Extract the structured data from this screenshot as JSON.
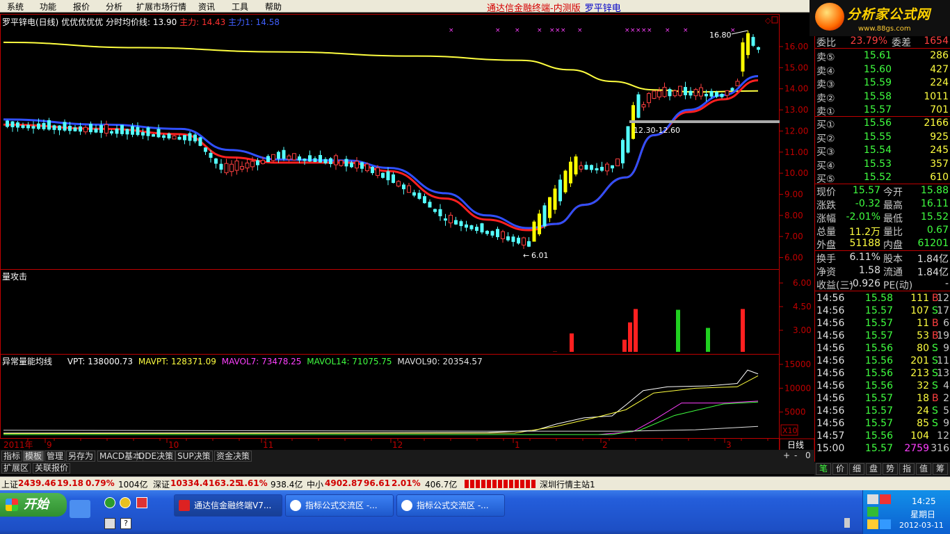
{
  "menu": [
    "系统",
    "功能",
    "报价",
    "分析",
    "扩展市场行情",
    "资讯",
    "工具",
    "帮助"
  ],
  "app_title": "通达信金融终端-内测版",
  "stock_name": "罗平锌电",
  "logo": {
    "text": "分析家公式网",
    "url": "www.88gs.com"
  },
  "main_chart": {
    "header_name": "罗平锌电(日线)",
    "header_tags": "优优优优优",
    "header_avg": "分时均价线: 13.90",
    "header_m1": "主力: 14.43",
    "header_m2": "主力1: 14.58",
    "max_label": "16.80",
    "min_label": "6.01",
    "range_label": "12.30-12.60",
    "price_ticks": [
      "16.00",
      "15.00",
      "14.00",
      "13.00",
      "12.00",
      "11.00",
      "10.00",
      "9.00",
      "8.00",
      "7.00",
      "6.00"
    ]
  },
  "volume_pane": {
    "title": "量攻击",
    "ticks": [
      "6.00",
      "4.50",
      "3.00"
    ]
  },
  "vpt_pane": {
    "title": "异常量能均线",
    "vpt": "VPT: 138000.73",
    "mavpt": "MAVPT: 128371.09",
    "mavol7": "MAVOL7: 73478.25",
    "mavol14": "MAVOL14: 71075.75",
    "mavol90": "MAVOL90: 20354.57",
    "ticks": [
      "15000",
      "10000",
      "5000"
    ],
    "scale": "X10"
  },
  "date_axis": {
    "year": "2011年",
    "months": [
      "9",
      "10",
      "11",
      "12",
      "1",
      "2",
      "3"
    ],
    "period": "日线"
  },
  "bottom_tabs": [
    "指标",
    "模板",
    "管理",
    "另存为",
    "MACD基本",
    "DDE决策",
    "SUP决策",
    "资金决策"
  ],
  "ext_tabs": [
    "扩展区",
    "关联报价"
  ],
  "right_panel": {
    "header_left": "委比",
    "header_val": "23.79%",
    "header_mid": "委差",
    "header_right": "1654",
    "sells": [
      {
        "label": "卖⑤",
        "price": "15.61",
        "vol": "286"
      },
      {
        "label": "卖④",
        "price": "15.60",
        "vol": "427"
      },
      {
        "label": "卖③",
        "price": "15.59",
        "vol": "224"
      },
      {
        "label": "卖②",
        "price": "15.58",
        "vol": "1011"
      },
      {
        "label": "卖①",
        "price": "15.57",
        "vol": "701"
      }
    ],
    "buys": [
      {
        "label": "买①",
        "price": "15.56",
        "vol": "2166"
      },
      {
        "label": "买②",
        "price": "15.55",
        "vol": "925"
      },
      {
        "label": "买③",
        "price": "15.54",
        "vol": "245"
      },
      {
        "label": "买④",
        "price": "15.53",
        "vol": "357"
      },
      {
        "label": "买⑤",
        "price": "15.52",
        "vol": "610"
      }
    ],
    "stats": [
      {
        "l1": "现价",
        "v1": "15.57",
        "l2": "今开",
        "v2": "15.88"
      },
      {
        "l1": "涨跌",
        "v1": "-0.32",
        "l2": "最高",
        "v2": "16.11"
      },
      {
        "l1": "涨幅",
        "v1": "-2.01%",
        "l2": "最低",
        "v2": "15.52"
      },
      {
        "l1": "总量",
        "v1": "11.2万",
        "l2": "量比",
        "v2": "0.67"
      },
      {
        "l1": "外盘",
        "v1": "51188",
        "l2": "内盘",
        "v2": "61201"
      }
    ],
    "stats2": [
      {
        "l1": "换手",
        "v1": "6.11%",
        "l2": "股本",
        "v2": "1.84亿"
      },
      {
        "l1": "净资",
        "v1": "1.58",
        "l2": "流通",
        "v2": "1.84亿"
      },
      {
        "l1": "收益(三)",
        "v1": "-0.926",
        "l2": "PE(动)",
        "v2": "-"
      }
    ],
    "ticks": [
      {
        "time": "14:56",
        "price": "15.58",
        "vol": "111",
        "side": "B",
        "n": "12"
      },
      {
        "time": "14:56",
        "price": "15.57",
        "vol": "107",
        "side": "S",
        "n": "17"
      },
      {
        "time": "14:56",
        "price": "15.57",
        "vol": "11",
        "side": "B",
        "n": "6"
      },
      {
        "time": "14:56",
        "price": "15.57",
        "vol": "53",
        "side": "B",
        "n": "19"
      },
      {
        "time": "14:56",
        "price": "15.56",
        "vol": "80",
        "side": "S",
        "n": "9"
      },
      {
        "time": "14:56",
        "price": "15.56",
        "vol": "201",
        "side": "S",
        "n": "11"
      },
      {
        "time": "14:56",
        "price": "15.56",
        "vol": "213",
        "side": "S",
        "n": "13"
      },
      {
        "time": "14:56",
        "price": "15.56",
        "vol": "32",
        "side": "S",
        "n": "4"
      },
      {
        "time": "14:56",
        "price": "15.57",
        "vol": "18",
        "side": "B",
        "n": "2"
      },
      {
        "time": "14:56",
        "price": "15.57",
        "vol": "24",
        "side": "S",
        "n": "5"
      },
      {
        "time": "14:56",
        "price": "15.57",
        "vol": "85",
        "side": "S",
        "n": "9"
      },
      {
        "time": "14:57",
        "price": "15.56",
        "vol": "104",
        "side": "",
        "n": "12"
      },
      {
        "time": "15:00",
        "price": "15.57",
        "vol": "2759",
        "side": "",
        "n": "316"
      }
    ],
    "tabs": [
      "笔",
      "价",
      "细",
      "盘",
      "势",
      "指",
      "值",
      "筹"
    ]
  },
  "statusbar": {
    "sh_label": "上证",
    "sh_val": "2439.46",
    "sh_chg": "19.18",
    "sh_pct": "0.79%",
    "sh_amt": "1004亿",
    "sz_label": "深证",
    "sz_val": "10334.4",
    "sz_chg": "163.25",
    "sz_pct": "1.61%",
    "sz_amt": "938.4亿",
    "zx_label": "中小",
    "zx_val": "4902.87",
    "zx_chg": "96.61",
    "zx_pct": "2.01%",
    "zx_amt": "406.7亿",
    "server": "深圳行情主站1"
  },
  "taskbar": {
    "start": "开始",
    "items": [
      "通达信金融终端V7...",
      "指标公式交流区 -...",
      "指标公式交流区 -..."
    ],
    "time": "14:25",
    "weekday": "星期日",
    "date": "2012-03-11"
  },
  "chart_data": {
    "type": "candlestick",
    "title": "罗平锌电(日线)",
    "ylim": [
      6.0,
      16.8
    ],
    "x_months": [
      "9",
      "10",
      "11",
      "12",
      "1",
      "2",
      "3"
    ],
    "annotations": {
      "high": 16.8,
      "low": 6.01,
      "range": "12.30-12.60"
    },
    "series": [
      {
        "name": "主力",
        "last": 14.43
      },
      {
        "name": "主力1",
        "last": 14.58
      },
      {
        "name": "分时均价线",
        "last": 13.9
      }
    ],
    "volume_ylim": [
      0,
      6.0
    ],
    "vpt": {
      "VPT": 138000.73,
      "MAVPT": 128371.09,
      "MAVOL7": 73478.25,
      "MAVOL14": 71075.75,
      "MAVOL90": 20354.57,
      "ylim": [
        0,
        15000
      ]
    }
  }
}
